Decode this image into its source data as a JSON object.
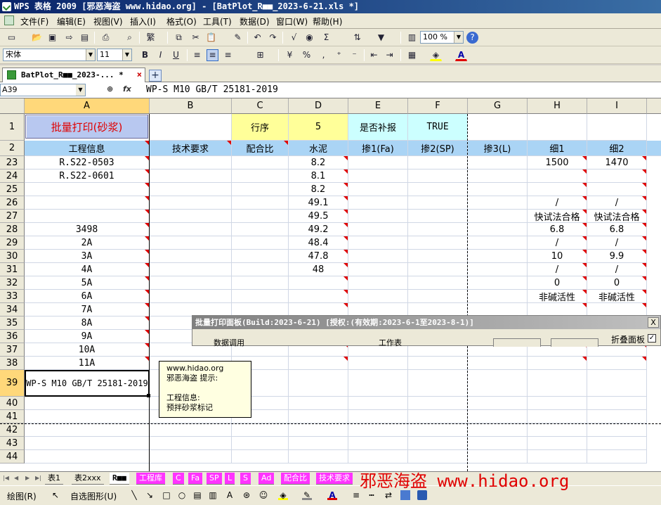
{
  "window": {
    "title": "WPS 表格 2009 [邪恶海盗 www.hidao.org] - [BatPlot_R■■_2023-6-21.xls *]"
  },
  "menu": [
    "文件(F)",
    "编辑(E)",
    "视图(V)",
    "插入(I)",
    "格式(O)",
    "工具(T)",
    "数据(D)",
    "窗口(W)",
    "帮助(H)"
  ],
  "toolbar": {
    "zoom": "100 %",
    "font": "宋体",
    "size": "11",
    "bold": "B",
    "italic": "I",
    "underline": "U",
    "percent": "%",
    "comma": ",",
    "sum": "Σ"
  },
  "file_tab": {
    "label": "BatPlot_R■■_2023-... *",
    "close": "×",
    "add": "+"
  },
  "formula_bar": {
    "cell_ref": "A39",
    "fx": "fx",
    "content": "WP-S M10 GB/T 25181-2019"
  },
  "columns": [
    "A",
    "B",
    "C",
    "D",
    "E",
    "F",
    "G",
    "H",
    "I"
  ],
  "row1": {
    "num": "1",
    "button": "批量打印(砂浆)",
    "row_order_label": "行序",
    "row_order_value": "5",
    "supplement_label": "是否补报",
    "supplement_value": "TRUE"
  },
  "headers": {
    "num": "2",
    "values": [
      "工程信息",
      "技术要求",
      "配合比",
      "水泥",
      "掺1(Fa)",
      "掺2(SP)",
      "掺3(L)",
      "细1",
      "细2"
    ]
  },
  "rows": [
    {
      "num": "23",
      "A": "R.S22-0503",
      "D": "8.2",
      "H": "1500",
      "I": "1470"
    },
    {
      "num": "24",
      "A": "R.S22-0601",
      "D": "8.1",
      "H": "",
      "I": ""
    },
    {
      "num": "25",
      "A": "",
      "D": "8.2",
      "H": "",
      "I": ""
    },
    {
      "num": "26",
      "A": "",
      "D": "49.1",
      "H": "/",
      "I": "/"
    },
    {
      "num": "27",
      "A": "",
      "D": "49.5",
      "H": "快试法合格",
      "I": "快试法合格"
    },
    {
      "num": "28",
      "A": "3498",
      "D": "49.2",
      "H": "6.8",
      "I": "6.8"
    },
    {
      "num": "29",
      "A": "2A",
      "D": "48.4",
      "H": "/",
      "I": "/"
    },
    {
      "num": "30",
      "A": "3A",
      "D": "47.8",
      "H": "10",
      "I": "9.9"
    },
    {
      "num": "31",
      "A": "4A",
      "D": "48",
      "H": "/",
      "I": "/"
    },
    {
      "num": "32",
      "A": "5A",
      "D": "",
      "H": "0",
      "I": "0"
    },
    {
      "num": "33",
      "A": "6A",
      "D": "",
      "H": "非碱活性",
      "I": "非碱活性"
    },
    {
      "num": "34",
      "A": "7A",
      "D": "",
      "H": "",
      "I": ""
    },
    {
      "num": "35",
      "A": "8A",
      "D": "",
      "H": "",
      "I": ""
    },
    {
      "num": "36",
      "A": "9A",
      "D": "",
      "H": "",
      "I": ""
    },
    {
      "num": "37",
      "A": "10A",
      "D": "",
      "H": "",
      "I": ""
    },
    {
      "num": "38",
      "A": "11A",
      "D": "",
      "H": "",
      "I": ""
    }
  ],
  "selected_row": {
    "num": "39",
    "A": "WP-S M10 GB/T 25181-2019"
  },
  "empty_rows": [
    "40",
    "41",
    "42",
    "43",
    "44"
  ],
  "tooltip": {
    "line1": "www.hidao.org",
    "line2": "邪恶海盗 提示:",
    "line3": "",
    "line4": "工程信息:",
    "line5": "预拌砂浆标记"
  },
  "panel": {
    "title": "批量打印面板(Build:2023-6-21) [授权:(有效期:2023-6-1至2023-8-1)]",
    "close": "X",
    "group1": "数据调用",
    "group2": "工作表",
    "fold_label": "折叠面板",
    "fold_checked": "✓"
  },
  "sheet_tabs": [
    "表1",
    "表2xxx",
    "R■■",
    "工程库",
    "C",
    "Fa",
    "SP",
    "L",
    "S",
    "Ad",
    "配合比",
    "技术要求"
  ],
  "watermark": "邪恶海盗 www.hidao.org",
  "drawbar": {
    "draw": "绘图(R)",
    "autoshape": "自选图形(U)"
  }
}
